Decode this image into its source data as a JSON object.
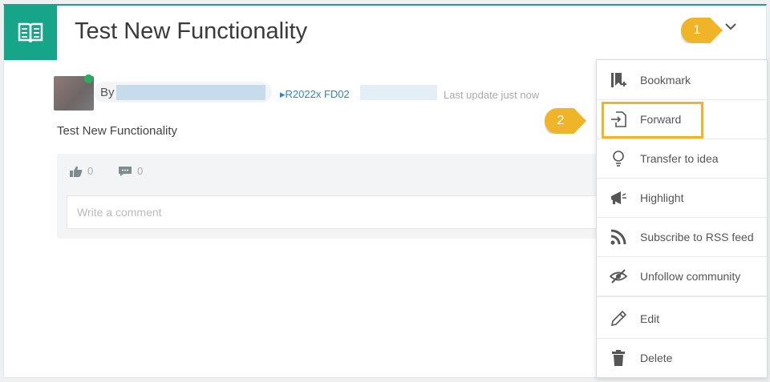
{
  "header": {
    "title": "Test New Functionality",
    "icon": "book-icon",
    "accent_color": "#17a589"
  },
  "callouts": {
    "step1": "1",
    "step2": "2",
    "color": "#f0b429"
  },
  "post": {
    "by_label": "By",
    "project_link": "▸R2022x FD02",
    "last_update": "Last update just now",
    "title": "Test New Functionality",
    "likes_count": "0",
    "comments_count": "0",
    "comment_placeholder": "Write a comment"
  },
  "menu": {
    "items": [
      {
        "label": "Bookmark",
        "icon": "bookmark-icon"
      },
      {
        "label": "Forward",
        "icon": "forward-icon"
      },
      {
        "label": "Transfer to idea",
        "icon": "lightbulb-icon"
      },
      {
        "label": "Highlight",
        "icon": "megaphone-icon"
      },
      {
        "label": "Subscribe to RSS feed",
        "icon": "rss-icon"
      },
      {
        "label": "Unfollow community",
        "icon": "eye-slash-icon"
      },
      {
        "label": "Edit",
        "icon": "pencil-icon"
      },
      {
        "label": "Delete",
        "icon": "trash-icon"
      }
    ]
  }
}
